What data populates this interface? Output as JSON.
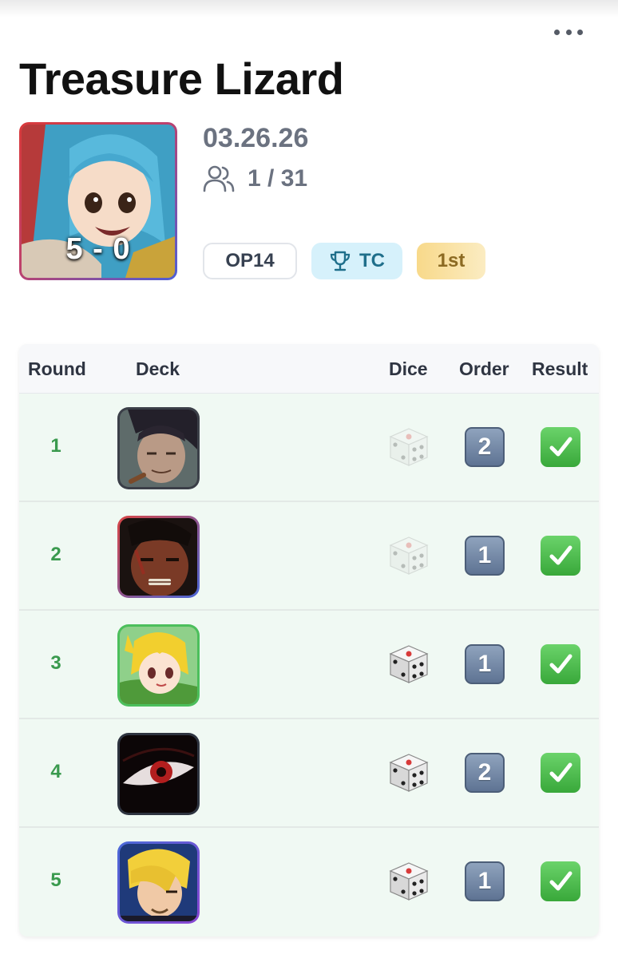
{
  "header": {
    "title": "Treasure Lizard",
    "more_icon": "more-horizontal-icon"
  },
  "event": {
    "score": "5 - 0",
    "date": "03.26.26",
    "players_icon": "users-icon",
    "players": "1 / 31",
    "set_badge": "OP14",
    "type_icon": "trophy-icon",
    "type_badge": "TC",
    "placement": "1st"
  },
  "table": {
    "columns": [
      "Round",
      "Deck",
      "Dice",
      "Order",
      "Result"
    ],
    "rows": [
      {
        "round": "1",
        "deck_art": "deck-art-crocodile",
        "dice": "faded",
        "order": "2",
        "result": "win"
      },
      {
        "round": "2",
        "deck_art": "deck-art-ace",
        "dice": "faded",
        "order": "1",
        "result": "win"
      },
      {
        "round": "3",
        "deck_art": "deck-art-carrot",
        "dice": "active",
        "order": "1",
        "result": "win"
      },
      {
        "round": "4",
        "deck_art": "deck-art-red-eye",
        "dice": "active",
        "order": "2",
        "result": "win"
      },
      {
        "round": "5",
        "deck_art": "deck-art-sanji",
        "dice": "active",
        "order": "1",
        "result": "win"
      }
    ]
  },
  "colors": {
    "accent_green": "#3a9a4e",
    "row_background": "#f0f9f3",
    "order_badge": "#6b7f9c",
    "result_badge": "#45b046"
  }
}
